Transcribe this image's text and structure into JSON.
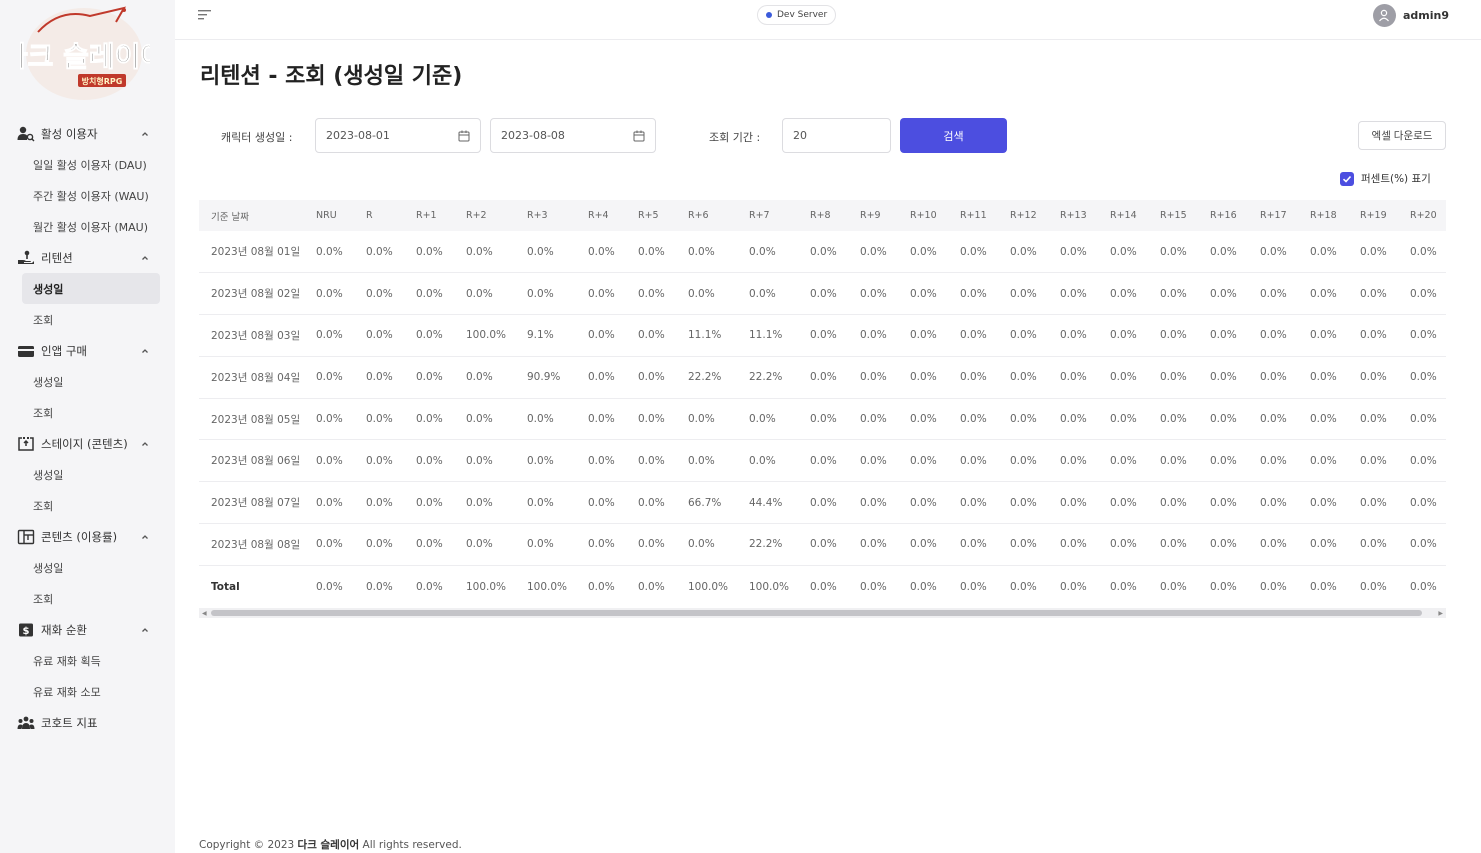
{
  "brand": {
    "logo_main": "다크 슬레이어",
    "logo_sub": "방치형RPG"
  },
  "server": "Dev Server",
  "user": "admin9",
  "sidebar": [
    {
      "label": "활성 이용자",
      "icon": "users-search-icon",
      "items": [
        {
          "label": "일일 활성 이용자 (DAU)"
        },
        {
          "label": "주간 활성 이용자 (WAU)"
        },
        {
          "label": "월간 활성 이용자 (MAU)"
        }
      ]
    },
    {
      "label": "리텐션",
      "icon": "hand-coin-icon",
      "items": [
        {
          "label": "생성일",
          "active": true
        },
        {
          "label": "조회"
        }
      ]
    },
    {
      "label": "인앱 구매",
      "icon": "card-icon",
      "items": [
        {
          "label": "생성일"
        },
        {
          "label": "조회"
        }
      ]
    },
    {
      "label": "스테이지 (콘텐츠)",
      "icon": "stage-icon",
      "items": [
        {
          "label": "생성일"
        },
        {
          "label": "조회"
        }
      ]
    },
    {
      "label": "콘텐츠 (이용률)",
      "icon": "layout-icon",
      "items": [
        {
          "label": "생성일"
        },
        {
          "label": "조회"
        }
      ]
    },
    {
      "label": "재화 순환",
      "icon": "dollar-icon",
      "items": [
        {
          "label": "유료 재화 획득"
        },
        {
          "label": "유료 재화 소모"
        }
      ]
    },
    {
      "label": "코호트 지표",
      "icon": "group-icon",
      "items": []
    }
  ],
  "page": {
    "title": "리텐션 - 조회 (생성일 기준)",
    "filters": {
      "created_label": "캐릭터 생성일 :",
      "start_date": "2023-08-01",
      "end_date": "2023-08-08",
      "period_label": "조회 기간 :",
      "period_value": "20",
      "search_label": "검색",
      "excel_label": "엑셀 다운로드",
      "percent_label": "퍼센트(%) 표기",
      "percent_checked": true
    }
  },
  "table": {
    "columns": [
      "기준 날짜",
      "NRU",
      "R",
      "R+1",
      "R+2",
      "R+3",
      "R+4",
      "R+5",
      "R+6",
      "R+7",
      "R+8",
      "R+9",
      "R+10",
      "R+11",
      "R+12",
      "R+13",
      "R+14",
      "R+15",
      "R+16",
      "R+17",
      "R+18",
      "R+19",
      "R+20"
    ],
    "rows": [
      [
        "2023년 08월 01일",
        "0.0%",
        "0.0%",
        "0.0%",
        "0.0%",
        "0.0%",
        "0.0%",
        "0.0%",
        "0.0%",
        "0.0%",
        "0.0%",
        "0.0%",
        "0.0%",
        "0.0%",
        "0.0%",
        "0.0%",
        "0.0%",
        "0.0%",
        "0.0%",
        "0.0%",
        "0.0%",
        "0.0%",
        "0.0%"
      ],
      [
        "2023년 08월 02일",
        "0.0%",
        "0.0%",
        "0.0%",
        "0.0%",
        "0.0%",
        "0.0%",
        "0.0%",
        "0.0%",
        "0.0%",
        "0.0%",
        "0.0%",
        "0.0%",
        "0.0%",
        "0.0%",
        "0.0%",
        "0.0%",
        "0.0%",
        "0.0%",
        "0.0%",
        "0.0%",
        "0.0%",
        "0.0%"
      ],
      [
        "2023년 08월 03일",
        "0.0%",
        "0.0%",
        "0.0%",
        "100.0%",
        "9.1%",
        "0.0%",
        "0.0%",
        "11.1%",
        "11.1%",
        "0.0%",
        "0.0%",
        "0.0%",
        "0.0%",
        "0.0%",
        "0.0%",
        "0.0%",
        "0.0%",
        "0.0%",
        "0.0%",
        "0.0%",
        "0.0%",
        "0.0%"
      ],
      [
        "2023년 08월 04일",
        "0.0%",
        "0.0%",
        "0.0%",
        "0.0%",
        "90.9%",
        "0.0%",
        "0.0%",
        "22.2%",
        "22.2%",
        "0.0%",
        "0.0%",
        "0.0%",
        "0.0%",
        "0.0%",
        "0.0%",
        "0.0%",
        "0.0%",
        "0.0%",
        "0.0%",
        "0.0%",
        "0.0%",
        "0.0%"
      ],
      [
        "2023년 08월 05일",
        "0.0%",
        "0.0%",
        "0.0%",
        "0.0%",
        "0.0%",
        "0.0%",
        "0.0%",
        "0.0%",
        "0.0%",
        "0.0%",
        "0.0%",
        "0.0%",
        "0.0%",
        "0.0%",
        "0.0%",
        "0.0%",
        "0.0%",
        "0.0%",
        "0.0%",
        "0.0%",
        "0.0%",
        "0.0%"
      ],
      [
        "2023년 08월 06일",
        "0.0%",
        "0.0%",
        "0.0%",
        "0.0%",
        "0.0%",
        "0.0%",
        "0.0%",
        "0.0%",
        "0.0%",
        "0.0%",
        "0.0%",
        "0.0%",
        "0.0%",
        "0.0%",
        "0.0%",
        "0.0%",
        "0.0%",
        "0.0%",
        "0.0%",
        "0.0%",
        "0.0%",
        "0.0%"
      ],
      [
        "2023년 08월 07일",
        "0.0%",
        "0.0%",
        "0.0%",
        "0.0%",
        "0.0%",
        "0.0%",
        "0.0%",
        "66.7%",
        "44.4%",
        "0.0%",
        "0.0%",
        "0.0%",
        "0.0%",
        "0.0%",
        "0.0%",
        "0.0%",
        "0.0%",
        "0.0%",
        "0.0%",
        "0.0%",
        "0.0%",
        "0.0%"
      ],
      [
        "2023년 08월 08일",
        "0.0%",
        "0.0%",
        "0.0%",
        "0.0%",
        "0.0%",
        "0.0%",
        "0.0%",
        "0.0%",
        "22.2%",
        "0.0%",
        "0.0%",
        "0.0%",
        "0.0%",
        "0.0%",
        "0.0%",
        "0.0%",
        "0.0%",
        "0.0%",
        "0.0%",
        "0.0%",
        "0.0%",
        "0.0%"
      ]
    ],
    "total": [
      "Total",
      "0.0%",
      "0.0%",
      "0.0%",
      "100.0%",
      "100.0%",
      "0.0%",
      "0.0%",
      "100.0%",
      "100.0%",
      "0.0%",
      "0.0%",
      "0.0%",
      "0.0%",
      "0.0%",
      "0.0%",
      "0.0%",
      "0.0%",
      "0.0%",
      "0.0%",
      "0.0%",
      "0.0%",
      "0.0%"
    ]
  },
  "footer": {
    "prefix": "Copyright © 2023",
    "brand": "다크 슬레이어",
    "suffix": "All rights reserved."
  },
  "colors": {
    "accent": "#4c4ee0",
    "sidebar_bg": "#f5f5f7",
    "logo_red": "#c0392b"
  }
}
